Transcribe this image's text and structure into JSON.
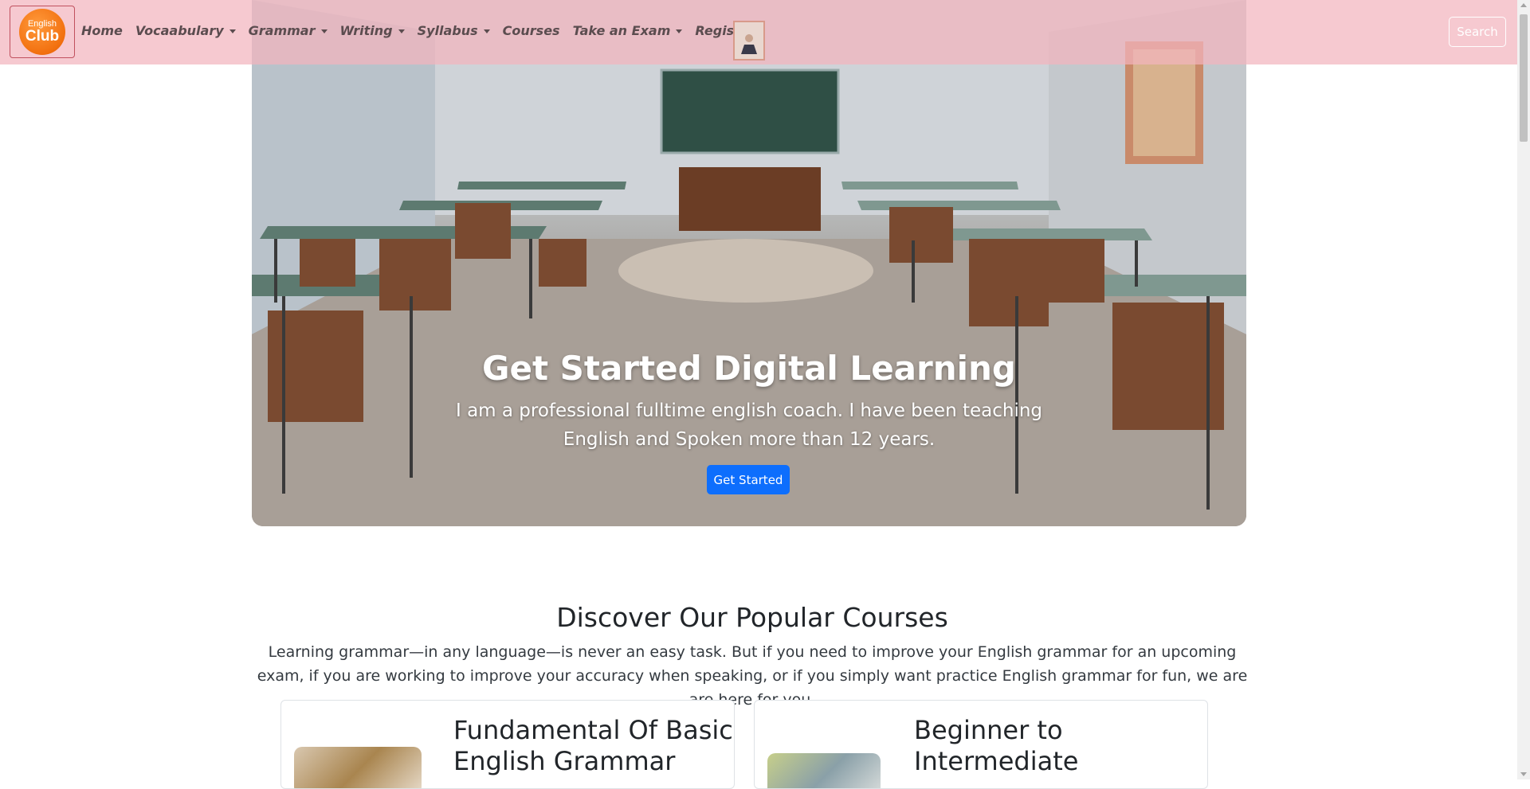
{
  "navbar": {
    "logo": {
      "line1": "English",
      "line2": "Club"
    },
    "items": [
      {
        "label": "Home",
        "dropdown": false
      },
      {
        "label": "Vocaabulary",
        "dropdown": true
      },
      {
        "label": "Grammar",
        "dropdown": true
      },
      {
        "label": "Writing",
        "dropdown": true
      },
      {
        "label": "Syllabus",
        "dropdown": true
      },
      {
        "label": "Courses",
        "dropdown": false
      },
      {
        "label": "Take an Exam",
        "dropdown": true
      },
      {
        "label": "Register",
        "dropdown": false
      }
    ],
    "search_label": "Search"
  },
  "hero": {
    "title": "Get Started Digital Learning",
    "subtitle": "I am a professional fulltime english coach. I have been teaching English and Spoken more than 12 years.",
    "button_label": "Get Started"
  },
  "courses_section": {
    "title": "Discover Our Popular Courses",
    "description": "Learning grammar—in any language—is never an easy task. But if you need to improve your English grammar for an upcoming exam, if you are working to improve your accuracy when speaking, or if you simply want practice English grammar for fun, we are are here for you.",
    "cards": [
      {
        "title_line1": "Fundamental Of Basic",
        "title_line2": "English Grammar"
      },
      {
        "title_line1": "Beginner to",
        "title_line2": "Intermediate"
      }
    ]
  },
  "colors": {
    "navbar_bg": "#f2b4be",
    "primary_button": "#0d6efd",
    "logo_orange": "#f2700f"
  }
}
